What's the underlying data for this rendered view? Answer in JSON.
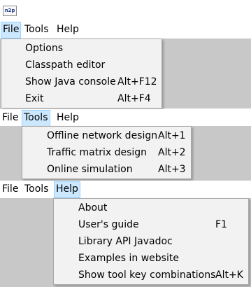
{
  "app": {
    "icon_text": "n2p"
  },
  "menubar": {
    "file": "File",
    "tools": "Tools",
    "help": "Help"
  },
  "file_menu": {
    "items": [
      {
        "label": "Options",
        "shortcut": ""
      },
      {
        "label": "Classpath editor",
        "shortcut": ""
      },
      {
        "label": "Show Java console",
        "shortcut": "Alt+F12"
      },
      {
        "label": "Exit",
        "shortcut": "Alt+F4"
      }
    ]
  },
  "tools_menu": {
    "items": [
      {
        "label": "Offline network design",
        "shortcut": "Alt+1"
      },
      {
        "label": "Traffic matrix design",
        "shortcut": "Alt+2"
      },
      {
        "label": "Online simulation",
        "shortcut": "Alt+3"
      }
    ]
  },
  "help_menu": {
    "items": [
      {
        "label": "About",
        "shortcut": ""
      },
      {
        "label": "User's guide",
        "shortcut": "F1"
      },
      {
        "label": "Library API Javadoc",
        "shortcut": ""
      },
      {
        "label": "Examples in website",
        "shortcut": ""
      },
      {
        "label": "Show tool key combinations",
        "shortcut": "Alt+K"
      }
    ]
  },
  "colors": {
    "menu_highlight": "#cce8ff",
    "menu_highlight_border": "#99d1ff",
    "dropdown_bg": "#f2f2f2",
    "content_bg": "#c8c8c8"
  }
}
